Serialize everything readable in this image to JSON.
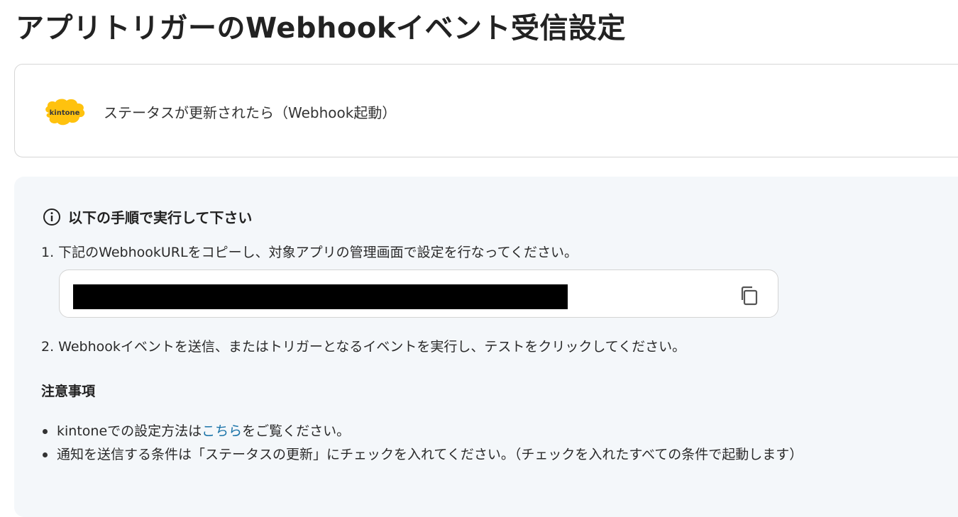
{
  "page": {
    "title": "アプリトリガーのWebhookイベント受信設定"
  },
  "trigger": {
    "app_icon": "kintone-logo",
    "logo_text": "kintone",
    "label": "ステータスが更新されたら（Webhook起動）"
  },
  "instructions": {
    "heading": "以下の手順で実行して下さい",
    "step1": "1. 下記のWebhookURLをコピーし、対象アプリの管理画面で設定を行なってください。",
    "url_value": "",
    "copy_icon": "copy-icon",
    "step2": "2. Webhookイベントを送信、またはトリガーとなるイベントを実行し、テストをクリックしてください。"
  },
  "notes": {
    "heading": "注意事項",
    "item1": {
      "prefix": "kintoneでの設定方法は",
      "link": "こちら",
      "suffix": "をご覧ください。"
    },
    "item2": "通知を送信する条件は「ステータスの更新」にチェックを入れてください。（チェックを入れたすべての条件で起動します）"
  },
  "colors": {
    "panel_bg": "#f4f7fa",
    "link": "#1a73a8",
    "kintone_yellow": "#ffc20e"
  }
}
